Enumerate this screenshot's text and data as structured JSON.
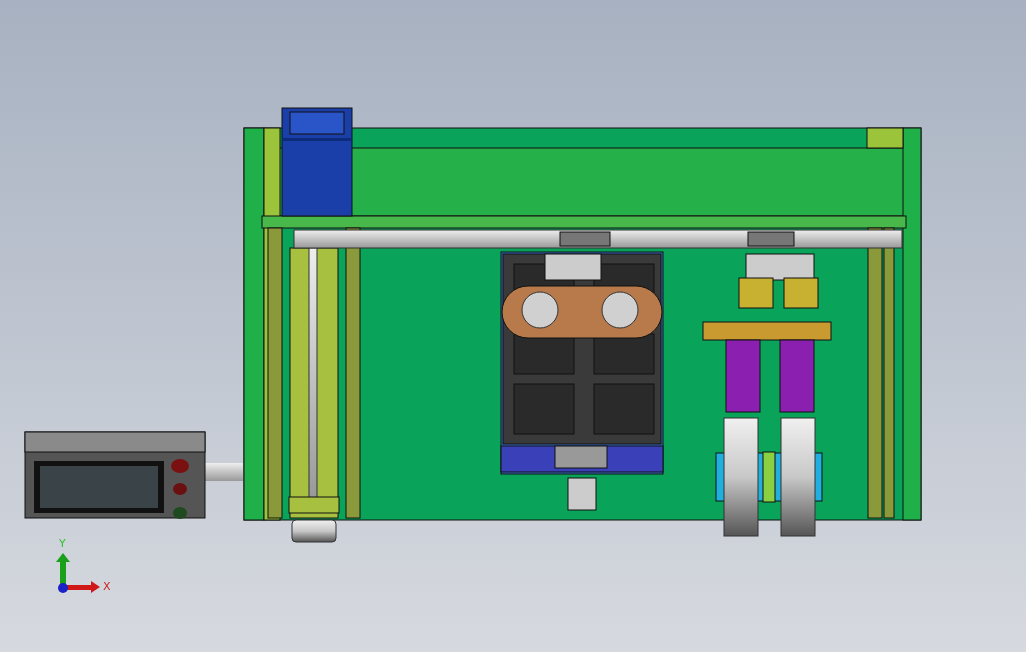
{
  "axis_triad": {
    "y_label": "Y",
    "x_label": "X"
  }
}
